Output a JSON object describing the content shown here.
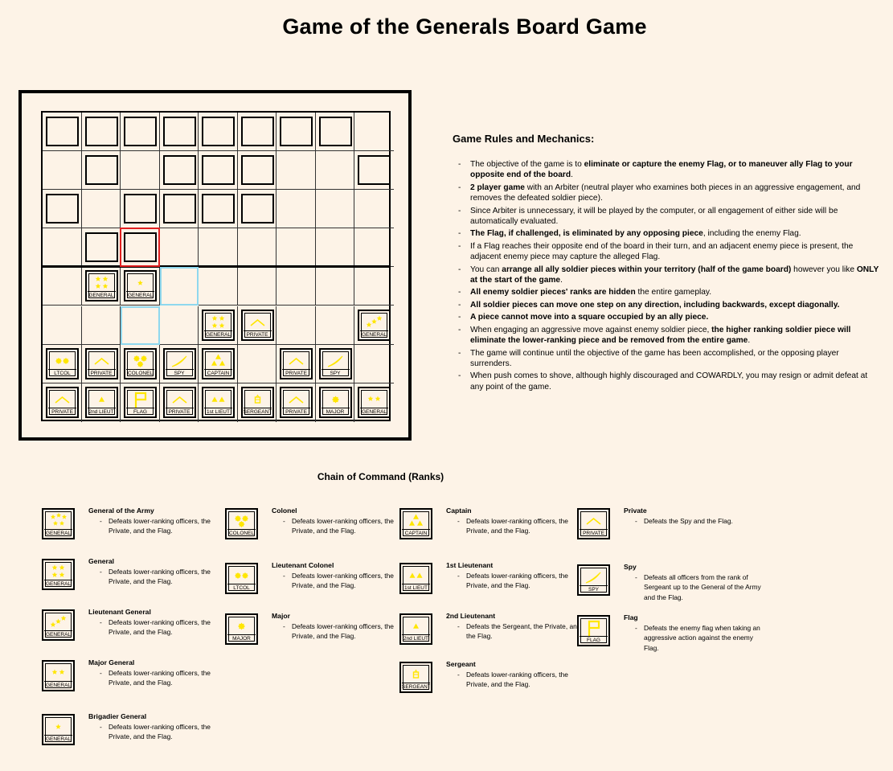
{
  "title": "Game of the Generals Board Game",
  "colors": {
    "background": "#fdf3e7",
    "emblem": "#ffe600",
    "selected": "#e02020",
    "move_hint": "#8fd8ee"
  },
  "board": {
    "cols": 9,
    "rows": 8,
    "hidden_pieces": [
      [
        0,
        0
      ],
      [
        1,
        0
      ],
      [
        2,
        0
      ],
      [
        3,
        0
      ],
      [
        4,
        0
      ],
      [
        5,
        0
      ],
      [
        6,
        0
      ],
      [
        7,
        0
      ],
      [
        1,
        1
      ],
      [
        3,
        1
      ],
      [
        4,
        1
      ],
      [
        5,
        1
      ],
      [
        8,
        1
      ],
      [
        0,
        2
      ],
      [
        2,
        2
      ],
      [
        3,
        2
      ],
      [
        4,
        2
      ],
      [
        5,
        2
      ],
      [
        1,
        3
      ],
      [
        2,
        3
      ]
    ],
    "selected_cell": [
      2,
      3
    ],
    "move_hints": [
      [
        3,
        4
      ],
      [
        2,
        5
      ]
    ],
    "pieces": [
      {
        "col": 1,
        "row": 4,
        "rank": "GENERAL",
        "emblem": "4stars"
      },
      {
        "col": 2,
        "row": 4,
        "rank": "GENERAL",
        "emblem": "1star"
      },
      {
        "col": 4,
        "row": 5,
        "rank": "GENERAL",
        "emblem": "4stars"
      },
      {
        "col": 5,
        "row": 5,
        "rank": "PRIVATE",
        "emblem": "chevron"
      },
      {
        "col": 8,
        "row": 5,
        "rank": "GENERAL",
        "emblem": "3stars"
      },
      {
        "col": 0,
        "row": 6,
        "rank": "LTCOL",
        "emblem": "2suns"
      },
      {
        "col": 1,
        "row": 6,
        "rank": "PRIVATE",
        "emblem": "chevron"
      },
      {
        "col": 2,
        "row": 6,
        "rank": "COLONEL",
        "emblem": "3suns"
      },
      {
        "col": 3,
        "row": 6,
        "rank": "SPY",
        "emblem": "spy"
      },
      {
        "col": 4,
        "row": 6,
        "rank": "CAPTAIN",
        "emblem": "3tri"
      },
      {
        "col": 6,
        "row": 6,
        "rank": "PRIVATE",
        "emblem": "chevron"
      },
      {
        "col": 7,
        "row": 6,
        "rank": "SPY",
        "emblem": "spy"
      },
      {
        "col": 0,
        "row": 7,
        "rank": "PRIVATE",
        "emblem": "chevron"
      },
      {
        "col": 1,
        "row": 7,
        "rank": "2nd LIEUT",
        "emblem": "1tri"
      },
      {
        "col": 2,
        "row": 7,
        "rank": "FLAG",
        "emblem": "flag"
      },
      {
        "col": 3,
        "row": 7,
        "rank": "PRIVATE",
        "emblem": "chevron"
      },
      {
        "col": 4,
        "row": 7,
        "rank": "1st LIEUT",
        "emblem": "2tri"
      },
      {
        "col": 5,
        "row": 7,
        "rank": "SERGEANT",
        "emblem": "sergeant"
      },
      {
        "col": 6,
        "row": 7,
        "rank": "PRIVATE",
        "emblem": "chevron"
      },
      {
        "col": 7,
        "row": 7,
        "rank": "MAJOR",
        "emblem": "1sun"
      },
      {
        "col": 8,
        "row": 7,
        "rank": "GENERAL",
        "emblem": "2stars"
      }
    ]
  },
  "rules": {
    "title": "Game Rules and Mechanics:",
    "items": [
      [
        {
          "t": "The objective of the game is to "
        },
        {
          "t": "eliminate or capture the enemy Flag, or to maneuver ally Flag to your opposite end of the board",
          "b": true
        },
        {
          "t": "."
        }
      ],
      [
        {
          "t": "2 player game",
          "b": true
        },
        {
          "t": " with an Arbiter (neutral player who examines both pieces in an aggressive engagement, and removes the defeated soldier piece)."
        }
      ],
      [
        {
          "t": "Since Arbiter is unnecessary, it will be played by the computer, or all engagement of either side will be automatically evaluated."
        }
      ],
      [
        {
          "t": "The Flag, if challenged, is eliminated by any opposing piece",
          "b": true
        },
        {
          "t": ", including the enemy Flag."
        }
      ],
      [
        {
          "t": "If a Flag reaches their opposite end of the board in their turn, and an adjacent enemy piece is present, the adjacent enemy piece may capture the alleged Flag."
        }
      ],
      [
        {
          "t": "You can "
        },
        {
          "t": "arrange all ally soldier pieces within your territory (half of the game board)",
          "b": true
        },
        {
          "t": " however you like "
        },
        {
          "t": "ONLY at the start of the game",
          "b": true
        },
        {
          "t": "."
        }
      ],
      [
        {
          "t": "All enemy soldier pieces' ranks are hidden",
          "b": true
        },
        {
          "t": " the entire gameplay."
        }
      ],
      [
        {
          "t": "All soldier pieces can move one step on any direction, including backwards, except diagonally.",
          "b": true
        }
      ],
      [
        {
          "t": "A piece cannot move into a square occupied by an ally piece.",
          "b": true
        }
      ],
      [
        {
          "t": "When engaging an aggressive move against enemy soldier piece, "
        },
        {
          "t": "the higher ranking soldier piece will eliminate the lower-ranking piece and be removed from the entire game",
          "b": true
        },
        {
          "t": "."
        }
      ],
      [
        {
          "t": "The game will continue until the objective of the game has been accomplished, or the opposing player surrenders."
        }
      ],
      [
        {
          "t": "When push comes to shove, although highly discouraged and COWARDLY, you may resign or admit defeat at any point of the game."
        }
      ]
    ]
  },
  "chain": {
    "title": "Chain of Command (Ranks)",
    "entries": [
      {
        "name": "General of the Army",
        "desc": "Defeats lower-ranking officers, the Private, and the Flag.",
        "label": "GENERAL",
        "emblem": "5stars"
      },
      {
        "name": "General",
        "desc": "Defeats lower-ranking officers, the Private, and the Flag.",
        "label": "GENERAL",
        "emblem": "4stars"
      },
      {
        "name": "Lieutenant General",
        "desc": "Defeats lower-ranking officers, the Private, and the Flag.",
        "label": "GENERAL",
        "emblem": "3stars"
      },
      {
        "name": "Major General",
        "desc": "Defeats lower-ranking officers, the Private, and the Flag.",
        "label": "GENERAL",
        "emblem": "2stars"
      },
      {
        "name": "Brigadier General",
        "desc": "Defeats lower-ranking officers, the Private, and the Flag.",
        "label": "GENERAL",
        "emblem": "1star"
      },
      {
        "name": "Colonel",
        "desc": "Defeats lower-ranking officers, the Private, and the Flag.",
        "label": "COLONEL",
        "emblem": "3suns"
      },
      {
        "name": "Lieutenant Colonel",
        "desc": "Defeats lower-ranking officers, the Private, and the Flag.",
        "label": "LTCOL",
        "emblem": "2suns"
      },
      {
        "name": "Major",
        "desc": "Defeats lower-ranking officers, the Private, and the Flag.",
        "label": "MAJOR",
        "emblem": "1sun"
      },
      {
        "name": "Captain",
        "desc": "Defeats lower-ranking officers, the Private, and the Flag.",
        "label": "CAPTAIN",
        "emblem": "3tri"
      },
      {
        "name": "1st Lieutenant",
        "desc": "Defeats lower-ranking officers, the Private, and the Flag.",
        "label": "1st LIEUT",
        "emblem": "2tri"
      },
      {
        "name": "2nd Lieutenant",
        "desc": "Defeats the Sergeant, the Private, and the Flag.",
        "label": "2nd LIEUT",
        "emblem": "1tri"
      },
      {
        "name": "Sergeant",
        "desc": "Defeats lower-ranking officers, the Private, and the Flag.",
        "label": "SERGEANT",
        "emblem": "sergeant"
      },
      {
        "name": "Private",
        "desc": "Defeats the Spy and the Flag.",
        "label": "PRIVATE",
        "emblem": "chevron"
      },
      {
        "name": "Spy",
        "desc": "Defeats all officers from the rank of Sergeant up to the General of the Army and the Flag.",
        "label": "SPY",
        "emblem": "spy"
      },
      {
        "name": "Flag",
        "desc": "Defeats the enemy flag when taking an aggressive action against the enemy Flag.",
        "label": "FLAG",
        "emblem": "flag"
      }
    ]
  }
}
